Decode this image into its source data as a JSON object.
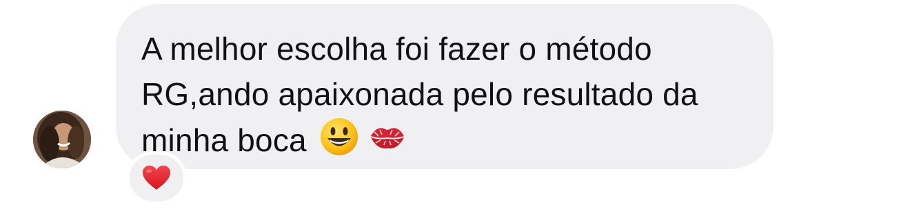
{
  "message": {
    "lines": [
      "A melhor escolha foi fazer o método",
      "RG,ando apaixonada pelo resultado da",
      "minha boca"
    ],
    "emojis": [
      "grinning-face-emoji",
      "kiss-mark-emoji"
    ],
    "bubble_color": "#f0f0f3",
    "text_color": "#111111"
  },
  "sender": {
    "avatar_icon": "profile-photo"
  },
  "reaction": {
    "emoji": "red-heart-emoji",
    "color": "#e0232c"
  }
}
